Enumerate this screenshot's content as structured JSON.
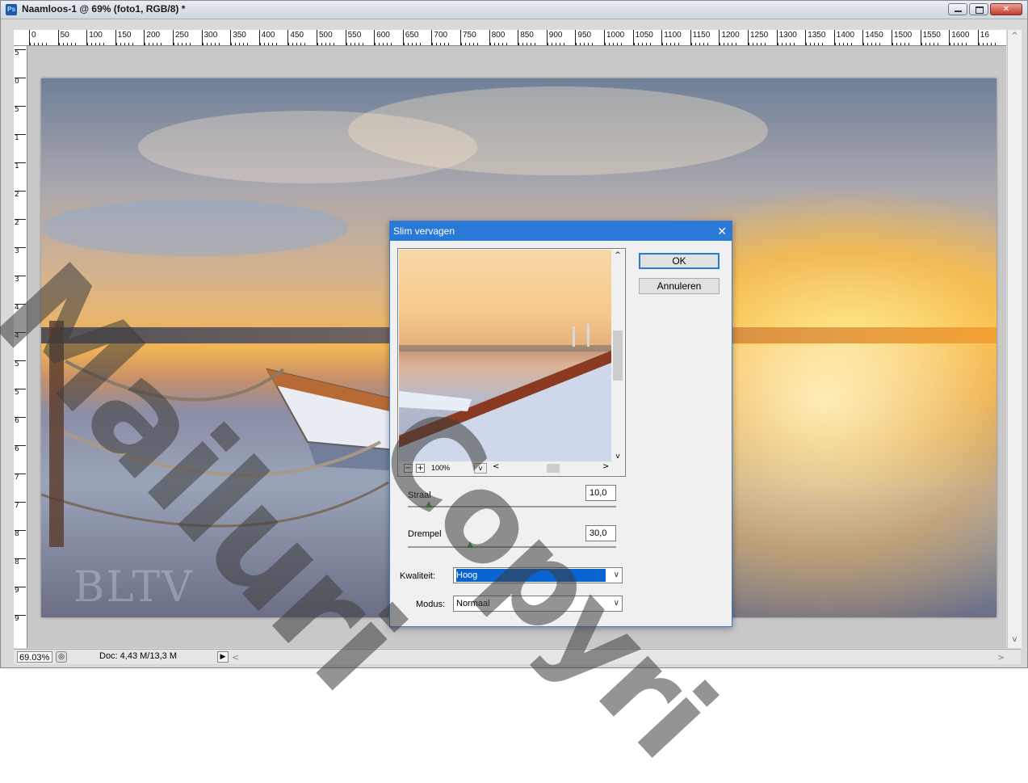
{
  "window": {
    "app_badge": "Ps",
    "title": "Naamloos-1 @ 69% (foto1, RGB/8) *"
  },
  "ruler": {
    "h_labels": [
      "0",
      "50",
      "100",
      "150",
      "200",
      "250",
      "300",
      "350",
      "400",
      "450",
      "500",
      "550",
      "600",
      "650",
      "700",
      "750",
      "800",
      "850",
      "900",
      "950",
      "1000",
      "1050",
      "1100",
      "1150",
      "1200",
      "1250",
      "1300",
      "1350",
      "1400",
      "1450",
      "1500",
      "1550",
      "1600",
      "16"
    ],
    "v_labels": [
      "5",
      "0",
      "5",
      "1",
      "1",
      "2",
      "2",
      "3",
      "3",
      "4",
      "4",
      "5",
      "5",
      "6",
      "6",
      "7",
      "7",
      "8",
      "8",
      "9",
      "9"
    ]
  },
  "canvas": {
    "photo_logo_text": "BLTV"
  },
  "statusbar": {
    "zoom": "69.03%",
    "doc": "Doc: 4,43 M/13,3 M"
  },
  "dialog": {
    "title": "Slim vervagen",
    "ok_label": "OK",
    "cancel_label": "Annuleren",
    "preview_zoom": "100%",
    "radius_label": "Straal",
    "radius_value": "10,0",
    "radius_fraction": 0.1,
    "threshold_label": "Drempel",
    "threshold_value": "30,0",
    "threshold_fraction": 0.3,
    "quality_label": "Kwaliteit:",
    "quality_value": "Hoog",
    "mode_label": "Modus:",
    "mode_value": "Normaal"
  },
  "overlay": {
    "watermark_line1": "Mailuri",
    "watermark_line2": "Copyri"
  },
  "colors": {
    "dialog_title_bg": "#2b79d7",
    "selection_bg": "#0a64d0",
    "slider_thumb": "#3c9a3c"
  }
}
